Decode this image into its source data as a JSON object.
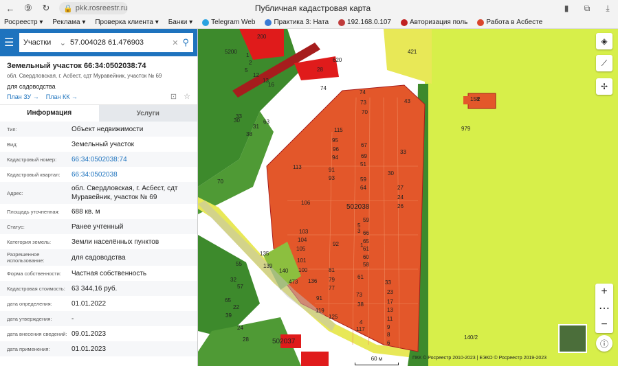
{
  "browser": {
    "url": "pkk.rosreestr.ru",
    "title": "Публичная кадастровая карта",
    "bookmarks": [
      {
        "label": "Росреестр ▾",
        "color": ""
      },
      {
        "label": "Реклама ▾",
        "color": ""
      },
      {
        "label": "Проверка клиента ▾",
        "color": ""
      },
      {
        "label": "Банки ▾",
        "color": ""
      },
      {
        "label": "Telegram Web",
        "color": "#2aa3e0"
      },
      {
        "label": "Практика 3: Ната",
        "color": "#3a7bd5"
      },
      {
        "label": "192.168.0.107",
        "color": "#c03b3b"
      },
      {
        "label": "Авторизация поль",
        "color": "#c02020"
      },
      {
        "label": "Работа в Асбесте",
        "color": "#d9452b"
      }
    ]
  },
  "search": {
    "type_label": "Участки",
    "query": "57.004028 61.476903"
  },
  "parcel": {
    "title": "Земельный участок 66:34:0502038:74",
    "address": "обл. Свердловская, г. Асбест, сдт Муравейник, участок № 69",
    "purpose": "для садоводства",
    "link_zu": "План ЗУ →",
    "link_kk": "План КК →"
  },
  "tabs": {
    "info": "Информация",
    "services": "Услуги"
  },
  "properties": [
    {
      "key": "Тип:",
      "value": "Объект недвижимости",
      "link": false
    },
    {
      "key": "Вид:",
      "value": "Земельный участок",
      "link": false
    },
    {
      "key": "Кадастровый номер:",
      "value": "66:34:0502038:74",
      "link": true
    },
    {
      "key": "Кадастровый квартал:",
      "value": "66:34:0502038",
      "link": true
    },
    {
      "key": "Адрес:",
      "value": "обл. Свердловская, г. Асбест, сдт Муравейник, участок № 69",
      "link": false
    },
    {
      "key": "Площадь уточненная:",
      "value": "688 кв. м",
      "link": false
    },
    {
      "key": "Статус:",
      "value": "Ранее учтенный",
      "link": false
    },
    {
      "key": "Категория земель:",
      "value": "Земли населённых пунктов",
      "link": false
    },
    {
      "key": "Разрешенное использование:",
      "value": "для садоводства",
      "link": false
    },
    {
      "key": "Форма собственности:",
      "value": "Частная собственность",
      "link": false
    },
    {
      "key": "Кадастровая стоимость:",
      "value": "63 344,16 руб.",
      "link": false
    },
    {
      "key": "дата определения:",
      "value": "01.01.2022",
      "link": false
    },
    {
      "key": "дата утверждения:",
      "value": "-",
      "link": false
    },
    {
      "key": "дата внесения сведений:",
      "value": "09.01.2023",
      "link": false
    },
    {
      "key": "дата применения:",
      "value": "01.01.2023",
      "link": false
    }
  ],
  "map": {
    "quarter_label": "502038",
    "quarter_label_2": "502037",
    "scale": "60 м",
    "copyright": "ПКК © Росреестр 2010-2023 | ЕЭКО © Росреестр 2019-2023",
    "labels": [
      "74",
      "73",
      "43",
      "70",
      "115",
      "95",
      "96",
      "94",
      "67",
      "69",
      "51",
      "33",
      "113",
      "91",
      "93",
      "59",
      "64",
      "30",
      "27",
      "24",
      "26",
      "106",
      "103",
      "104",
      "59",
      "66",
      "65",
      "61",
      "60",
      "58",
      "92",
      "105",
      "101",
      "100",
      "81",
      "79",
      "77",
      "73",
      "61",
      "38",
      "33",
      "23",
      "17",
      "13",
      "11",
      "9",
      "8",
      "6",
      "117",
      "4",
      "3",
      "5",
      "1",
      "139",
      "140",
      "473",
      "135",
      "136",
      "91",
      "119",
      "125",
      "55",
      "57",
      "32",
      "65",
      "39",
      "30",
      "33",
      "31",
      "38",
      "63",
      "70",
      "22",
      "24",
      "28",
      "421",
      "979",
      "158",
      "2",
      "140/2",
      "620",
      "28",
      "74",
      "200",
      "5200",
      "1",
      "2",
      "5",
      "12",
      "13",
      "16"
    ]
  },
  "colors": {
    "primary": "#1e73be",
    "parcel_orange": "#e3572a",
    "map_yellow": "#d7ef4a",
    "green": "#3b8a2a",
    "red": "#e01b1b"
  },
  "icons": [
    "menu-icon",
    "search-icon",
    "clear-icon",
    "layers-icon",
    "ruler-icon",
    "locate-icon",
    "zoom-in-icon",
    "zoom-out-icon"
  ]
}
